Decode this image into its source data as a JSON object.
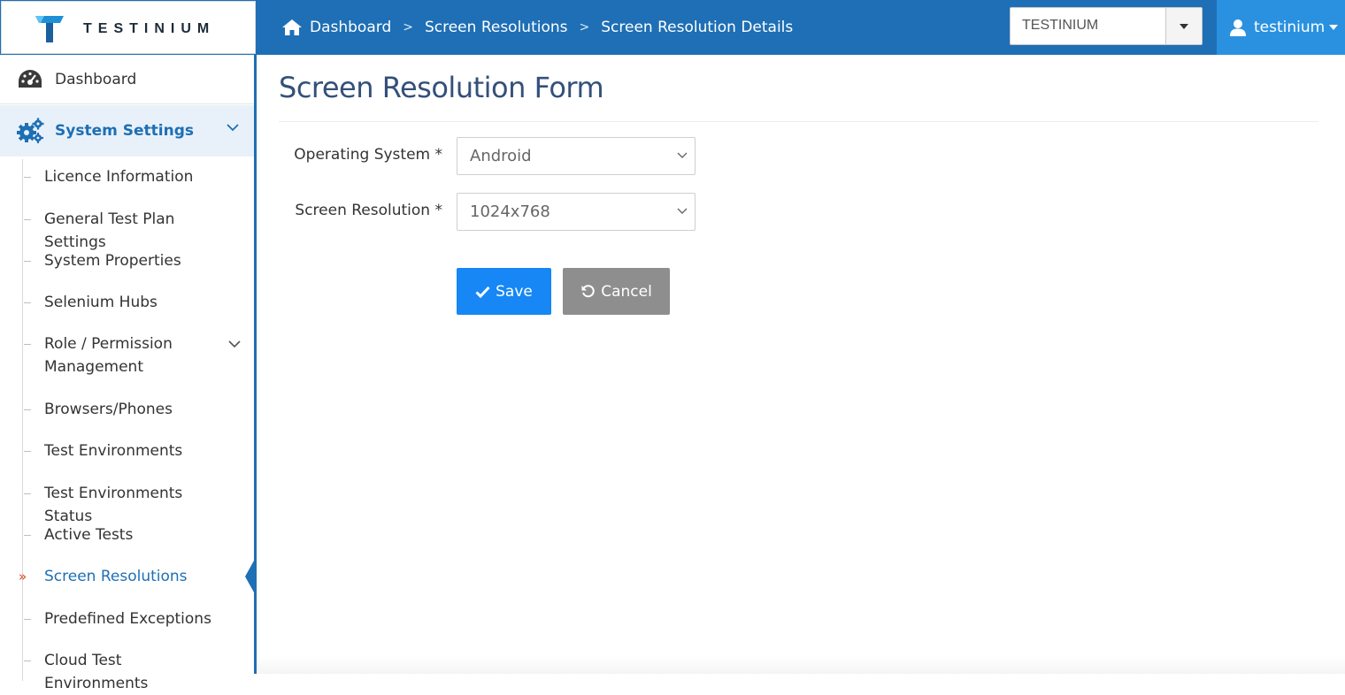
{
  "brand": {
    "name": "TESTINIUM"
  },
  "breadcrumb": [
    "Dashboard",
    "Screen Resolutions",
    "Screen Resolution Details"
  ],
  "project_selector": {
    "value": "TESTINIUM"
  },
  "user": {
    "name": "testinium"
  },
  "sidebar": {
    "dashboard": "Dashboard",
    "system_settings": "System Settings",
    "items": [
      {
        "label": "Licence Information"
      },
      {
        "label": "General Test Plan Settings"
      },
      {
        "label": "System Properties"
      },
      {
        "label": "Selenium Hubs"
      },
      {
        "label": "Role / Permission\nManagement",
        "label_line1": "Role / Permission",
        "label_line2": "Management"
      },
      {
        "label": "Browsers/Phones"
      },
      {
        "label": "Test Environments"
      },
      {
        "label": "Test Environments Status"
      },
      {
        "label": "Active Tests"
      },
      {
        "label": "Screen Resolutions",
        "active": true
      },
      {
        "label": "Predefined Exceptions"
      },
      {
        "label": "Cloud Test Environments"
      }
    ]
  },
  "form": {
    "title": "Screen Resolution Form",
    "os_label": "Operating System  *",
    "os_value": "Android",
    "resolution_label": "Screen Resolution  *",
    "resolution_value": "1024x768",
    "save_label": "Save",
    "cancel_label": "Cancel"
  },
  "colors": {
    "topbar": "#1e6fb5",
    "user_menu": "#2a91e0",
    "save_button": "#1687f5",
    "cancel_button": "#8e8e8e",
    "active_item": "#1e6fb5",
    "active_marker": "#d9441b"
  },
  "icons": {
    "home": "home-icon",
    "user": "user-icon",
    "dashboard": "dashboard-gauge-icon",
    "settings": "gears-icon",
    "save": "check-icon",
    "cancel": "undo-icon"
  }
}
